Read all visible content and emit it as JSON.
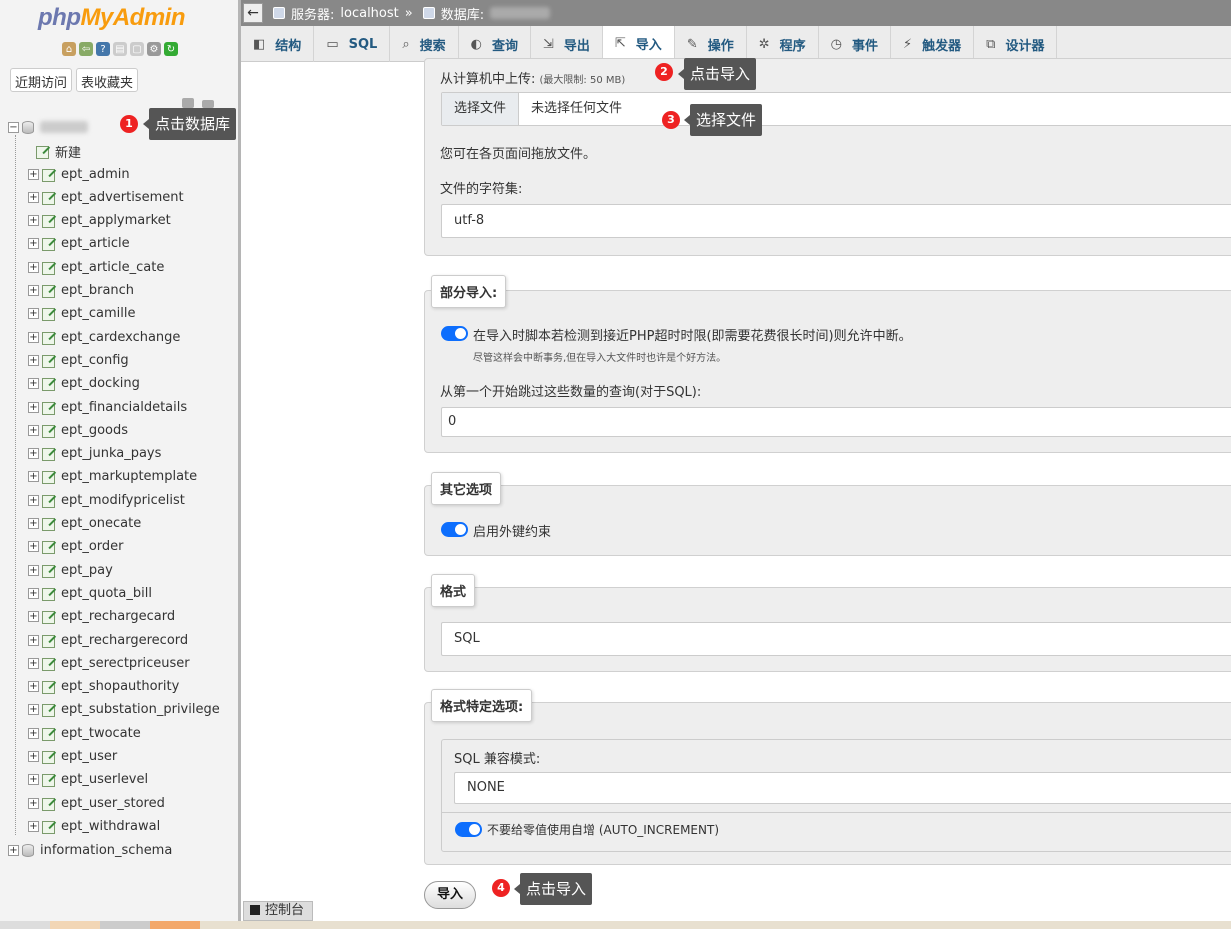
{
  "app": {
    "logo_php": "php",
    "logo_ma": "MyAdmin"
  },
  "sidebar": {
    "recent_btn": "近期访问",
    "favorites_btn": "表收藏夹",
    "new_label": "新建",
    "tables": [
      "ept_admin",
      "ept_advertisement",
      "ept_applymarket",
      "ept_article",
      "ept_article_cate",
      "ept_branch",
      "ept_camille",
      "ept_cardexchange",
      "ept_config",
      "ept_docking",
      "ept_financialdetails",
      "ept_goods",
      "ept_junka_pays",
      "ept_markuptemplate",
      "ept_modifypricelist",
      "ept_onecate",
      "ept_order",
      "ept_pay",
      "ept_quota_bill",
      "ept_rechargecard",
      "ept_rechargerecord",
      "ept_serectpriceuser",
      "ept_shopauthority",
      "ept_substation_privilege",
      "ept_twocate",
      "ept_user",
      "ept_userlevel",
      "ept_user_stored",
      "ept_withdrawal"
    ],
    "other_db": "information_schema"
  },
  "breadcrumb": {
    "server_label": "服务器:",
    "server_value": "localhost",
    "sep": "»",
    "db_label": "数据库:"
  },
  "tabs": [
    {
      "label": "结构",
      "icon": "structure-icon"
    },
    {
      "label": "SQL",
      "icon": "sql-icon"
    },
    {
      "label": "搜索",
      "icon": "search-icon"
    },
    {
      "label": "查询",
      "icon": "query-icon"
    },
    {
      "label": "导出",
      "icon": "export-icon"
    },
    {
      "label": "导入",
      "icon": "import-icon"
    },
    {
      "label": "操作",
      "icon": "wrench-icon"
    },
    {
      "label": "程序",
      "icon": "routines-icon"
    },
    {
      "label": "事件",
      "icon": "clock-icon"
    },
    {
      "label": "触发器",
      "icon": "trigger-icon"
    },
    {
      "label": "设计器",
      "icon": "designer-icon"
    }
  ],
  "upload": {
    "label": "从计算机中上传:",
    "limit": "(最大限制: 50 MB)",
    "choose_btn": "选择文件",
    "no_file": "未选择任何文件",
    "drag_hint": "您可在各页面间拖放文件。",
    "charset_label": "文件的字符集:",
    "charset_value": "utf-8"
  },
  "partial": {
    "legend": "部分导入:",
    "allow_interrupt": "在导入时脚本若检测到接近PHP超时时限(即需要花费很长时间)则允许中断。",
    "interrupt_hint": "尽管这样会中断事务,但在导入大文件时也许是个好方法。",
    "skip_label": "从第一个开始跳过这些数量的查询(对于SQL):",
    "skip_value": "0"
  },
  "other": {
    "legend": "其它选项",
    "fk_label": "启用外键约束"
  },
  "format": {
    "legend": "格式",
    "value": "SQL"
  },
  "format_opts": {
    "legend": "格式特定选项:",
    "compat_label": "SQL 兼容模式:",
    "compat_value": "NONE",
    "auto_inc_label": "不要给零值使用自增 (AUTO_INCREMENT)"
  },
  "import_btn": "导入",
  "console": "控制台",
  "annotations": [
    {
      "num": "1",
      "text": "点击数据库"
    },
    {
      "num": "2",
      "text": "点击导入"
    },
    {
      "num": "3",
      "text": "选择文件"
    },
    {
      "num": "4",
      "text": "点击导入"
    }
  ]
}
